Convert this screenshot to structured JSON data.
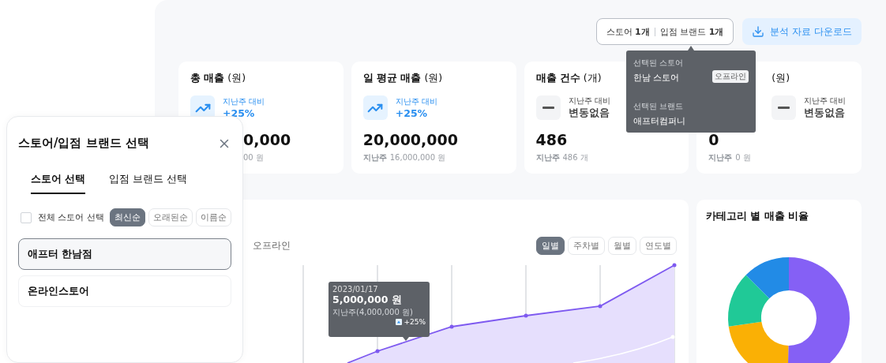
{
  "toolbar": {
    "selection_summary": {
      "store_label": "스토어",
      "store_count": "1개",
      "brand_label": "입점 브랜드",
      "brand_count": "1개"
    },
    "download_button": "분석 자료 다운로드"
  },
  "selection_popover": {
    "store_heading": "선택된 스토어",
    "store_name": "한남 스토어",
    "store_badge": "오프라인",
    "brand_heading": "선택된 브랜드",
    "brand_name": "애프터컴퍼니"
  },
  "metric_cards": [
    {
      "title": "총 매출",
      "unit": "(원)",
      "change_label": "지난주 대비",
      "change_value": "+25%",
      "kind": "up",
      "covered": true,
      "value": "0,000",
      "previous_value": "00 원"
    },
    {
      "title": "일 평균 매출",
      "unit": "(원)",
      "change_label": "지난주 대비",
      "change_value": "+25%",
      "kind": "up",
      "covered": false,
      "value": "20,000,000",
      "previous_label": "지난주",
      "previous_value": "16,000,000 원"
    },
    {
      "title": "매출 건수",
      "unit": "(개)",
      "change_label": "지난주 대비",
      "change_value": "변동없음",
      "kind": "flat",
      "covered": false,
      "value": "486",
      "previous_label": "지난주",
      "previous_value": "486 개"
    },
    {
      "unit": "(원)",
      "change_label": "지난주 대비",
      "change_value": "변동없음",
      "kind": "flat",
      "covered": true,
      "value": "0",
      "previous_label": "지난주",
      "previous_value": "0 원"
    }
  ],
  "sales_chart": {
    "legend": "오프라인",
    "periods": [
      {
        "label": "일별",
        "selected": true
      },
      {
        "label": "주차별",
        "selected": false
      },
      {
        "label": "월별",
        "selected": false
      },
      {
        "label": "연도별",
        "selected": false
      }
    ],
    "tooltip": {
      "date": "2023/01/17",
      "value": "5,000,000 원",
      "previous": "지난주(4,000,000 원)",
      "change": "+25%"
    }
  },
  "category_chart": {
    "title": "카테고리 별 매출 비율"
  },
  "selection_dialog": {
    "title": "스토어/입점 브랜드 선택",
    "tabs": [
      {
        "label": "스토어 선택",
        "selected": true
      },
      {
        "label": "입점 브랜드 선택",
        "selected": false
      }
    ],
    "select_all": {
      "label": "전체 스토어 선택",
      "checked": false
    },
    "sort_options": [
      {
        "label": "최신순",
        "selected": true
      },
      {
        "label": "오래된순",
        "selected": false
      },
      {
        "label": "이름순",
        "selected": false
      }
    ],
    "stores": [
      {
        "name": "애프터 한남점",
        "selected": true
      },
      {
        "name": "온라인스토어",
        "selected": false
      }
    ]
  }
}
